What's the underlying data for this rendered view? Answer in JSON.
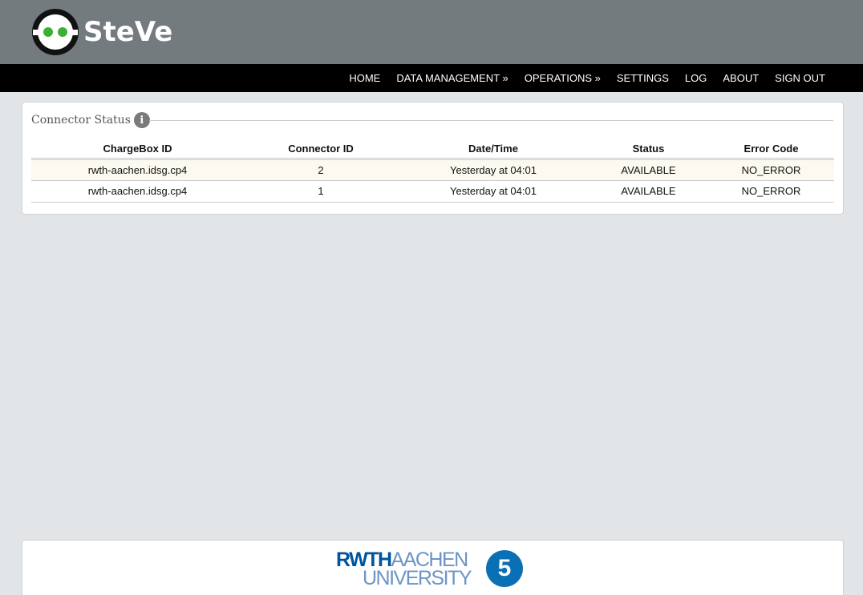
{
  "app": {
    "name": "SteVe"
  },
  "nav": {
    "items": [
      {
        "label": "HOME"
      },
      {
        "label": "DATA MANAGEMENT »"
      },
      {
        "label": "OPERATIONS »"
      },
      {
        "label": "SETTINGS"
      },
      {
        "label": "LOG"
      },
      {
        "label": "ABOUT"
      },
      {
        "label": "SIGN OUT"
      }
    ]
  },
  "panel": {
    "title": "Connector Status",
    "info_icon": "info-icon",
    "columns": [
      "ChargeBox ID",
      "Connector ID",
      "Date/Time",
      "Status",
      "Error Code"
    ],
    "rows": [
      {
        "chargebox_id": "rwth-aachen.idsg.cp4",
        "connector_id": "2",
        "datetime": "Yesterday at 04:01",
        "status": "AVAILABLE",
        "error_code": "NO_ERROR"
      },
      {
        "chargebox_id": "rwth-aachen.idsg.cp4",
        "connector_id": "1",
        "datetime": "Yesterday at 04:01",
        "status": "AVAILABLE",
        "error_code": "NO_ERROR"
      }
    ]
  },
  "footer": {
    "logo_line1_a": "RWTH",
    "logo_line1_b": "AACHEN",
    "logo_line2": "UNIVERSITY",
    "badge": "5"
  },
  "colors": {
    "header_bg": "#737b7e",
    "navbar_bg": "#000000",
    "page_bg": "#e1e5e8",
    "logo_eye": "#3cb034",
    "rwth_blue": "#00549f"
  }
}
